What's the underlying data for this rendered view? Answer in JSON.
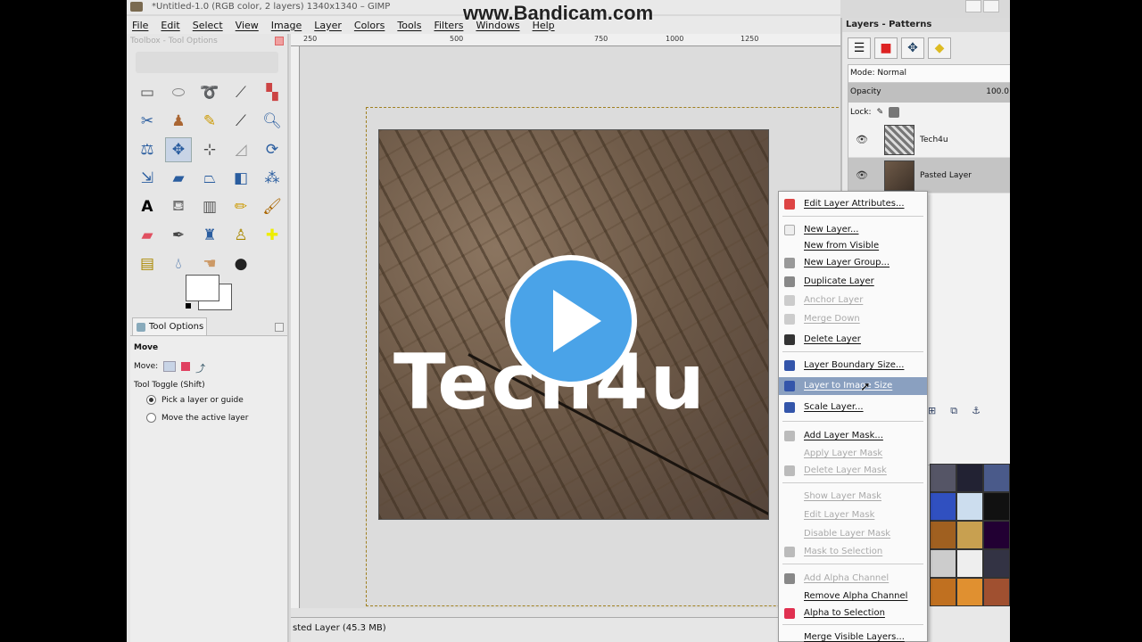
{
  "window": {
    "title": "*Untitled-1.0 (RGB color, 2 layers) 1340x1340 – GIMP",
    "watermark": "www.Bandicam.com"
  },
  "menubar": [
    "File",
    "Edit",
    "Select",
    "View",
    "Image",
    "Layer",
    "Colors",
    "Tools",
    "Filters",
    "Windows",
    "Help"
  ],
  "toolbox": {
    "title": "Toolbox - Tool Options",
    "tools": [
      "rect-select",
      "ellipse-select",
      "free-select",
      "fuzzy-select",
      "color-select",
      "scissors",
      "foreground-select",
      "paths",
      "color-picker",
      "zoom",
      "measure",
      "move",
      "align",
      "crop",
      "rotate",
      "scale",
      "shear",
      "perspective",
      "flip",
      "cage",
      "text",
      "bucket-fill",
      "blend",
      "pencil",
      "paintbrush",
      "eraser",
      "airbrush",
      "ink",
      "clone",
      "heal",
      "perspective-clone",
      "blur",
      "smudge",
      "dodge-burn"
    ],
    "tool_options_tab": "Tool Options",
    "tool_name": "Move",
    "move_label": "Move:",
    "toggle_label": "Tool Toggle  (Shift)",
    "option_pick": "Pick a layer or guide",
    "option_move": "Move the active layer"
  },
  "ruler": {
    "ticks": [
      "250",
      "500",
      "750",
      "1000",
      "1250"
    ]
  },
  "canvas": {
    "image_text": "Tech4u"
  },
  "status": {
    "text": "sted Layer (45.3 MB)"
  },
  "layers": {
    "title": "Layers - Patterns",
    "mode": "Mode: Normal",
    "opacity_label": "Opacity",
    "opacity_value": "100.0",
    "lock_label": "Lock:",
    "items": [
      {
        "name": "Tech4u",
        "selected": false
      },
      {
        "name": "Pasted Layer",
        "selected": true
      }
    ]
  },
  "context_menu": {
    "items": [
      {
        "label": "Edit Layer Attributes...",
        "enabled": true,
        "icon": "edit-icon"
      },
      {
        "label": "New Layer...",
        "enabled": true,
        "icon": "new-layer-icon"
      },
      {
        "label": "New from Visible",
        "enabled": true,
        "icon": ""
      },
      {
        "label": "New Layer Group...",
        "enabled": true,
        "icon": "folder-icon"
      },
      {
        "label": "Duplicate Layer",
        "enabled": true,
        "icon": "duplicate-icon"
      },
      {
        "label": "Anchor Layer",
        "enabled": false,
        "icon": "anchor-icon"
      },
      {
        "label": "Merge Down",
        "enabled": false,
        "icon": "merge-icon"
      },
      {
        "label": "Delete Layer",
        "enabled": true,
        "icon": "trash-icon"
      },
      {
        "label": "Layer Boundary Size...",
        "enabled": true,
        "icon": "boundary-icon"
      },
      {
        "label": "Layer to Image Size",
        "enabled": true,
        "icon": "fit-icon"
      },
      {
        "label": "Scale Layer...",
        "enabled": true,
        "icon": "scale-icon"
      },
      {
        "label": "Add Layer Mask...",
        "enabled": true,
        "icon": "mask-icon"
      },
      {
        "label": "Apply Layer Mask",
        "enabled": false,
        "icon": ""
      },
      {
        "label": "Delete Layer Mask",
        "enabled": false,
        "icon": "trash-icon"
      },
      {
        "label": "Show Layer Mask",
        "enabled": false,
        "icon": ""
      },
      {
        "label": "Edit Layer Mask",
        "enabled": false,
        "icon": ""
      },
      {
        "label": "Disable Layer Mask",
        "enabled": false,
        "icon": ""
      },
      {
        "label": "Mask to Selection",
        "enabled": false,
        "icon": "selection-icon"
      },
      {
        "label": "Add Alpha Channel",
        "enabled": false,
        "icon": "alpha-icon"
      },
      {
        "label": "Remove Alpha Channel",
        "enabled": true,
        "icon": ""
      },
      {
        "label": "Alpha to Selection",
        "enabled": true,
        "icon": "alpha-select-icon"
      },
      {
        "label": "Merge Visible Layers...",
        "enabled": true,
        "icon": ""
      }
    ]
  },
  "colors": {
    "play_button": "#4aa3e8",
    "highlight": "#8aa0c0"
  }
}
